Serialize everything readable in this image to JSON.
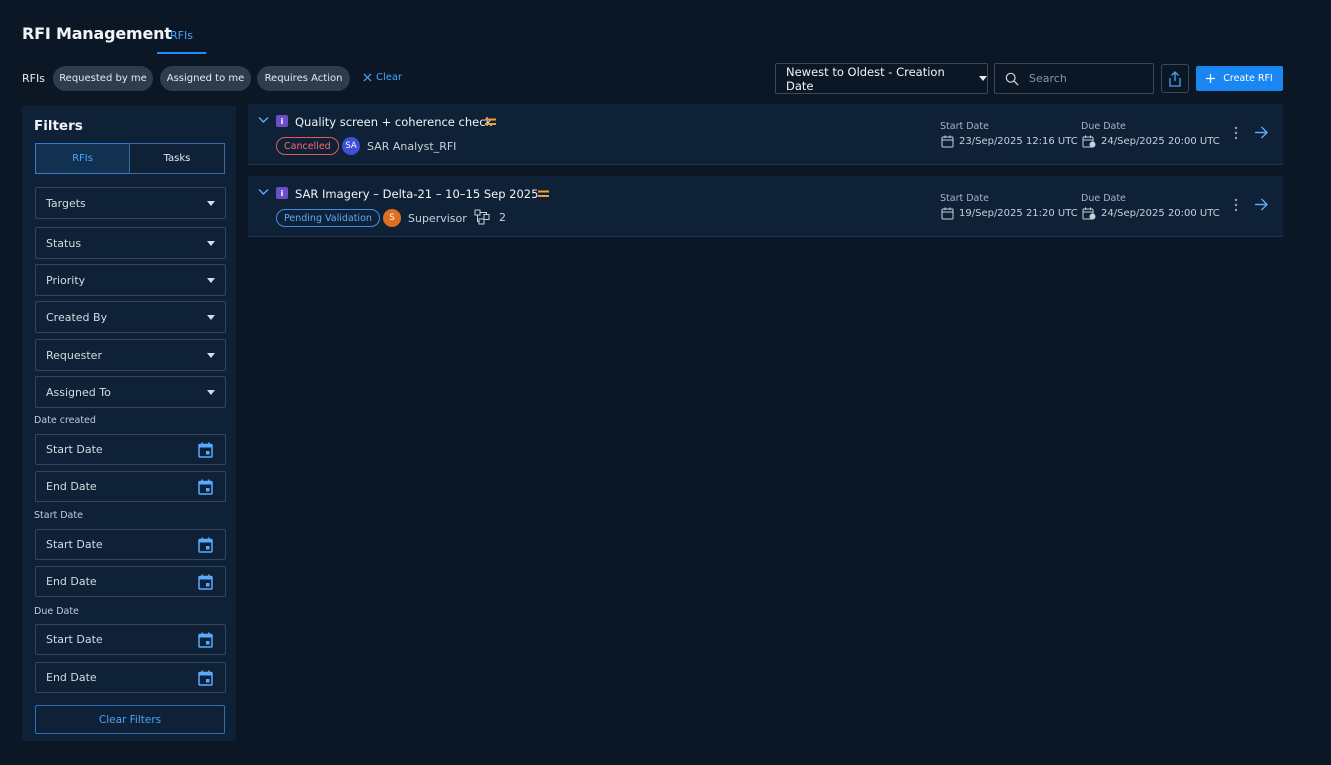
{
  "header": {
    "title": "RFI Management",
    "tab": "RFIs"
  },
  "quick_filters": {
    "label": "RFIs",
    "chips": [
      "Requested by me",
      "Assigned to me",
      "Requires Action"
    ],
    "clear": "Clear"
  },
  "toolbar": {
    "sort_value": "Newest to Oldest - Creation Date",
    "search_placeholder": "Search",
    "create_label": "Create RFI"
  },
  "sidebar": {
    "title": "Filters",
    "segments": [
      "RFIs",
      "Tasks"
    ],
    "active_segment": "RFIs",
    "dropdowns": [
      "Targets",
      "Status",
      "Priority",
      "Created By",
      "Requester",
      "Assigned To"
    ],
    "date_groups": [
      {
        "label": "Date created",
        "start": "Start Date",
        "end": "End Date"
      },
      {
        "label": "Start Date",
        "start": "Start Date",
        "end": "End Date"
      },
      {
        "label": "Due Date",
        "start": "Start Date",
        "end": "End Date"
      }
    ],
    "clear_filters": "Clear Filters"
  },
  "rfis": [
    {
      "title": "Quality screen + coherence check",
      "status": "Cancelled",
      "owner_initials": "SA",
      "owner": "SAR Analyst_RFI",
      "start_label": "Start Date",
      "start": "23/Sep/2025 12:16 UTC",
      "due_label": "Due Date",
      "due": "24/Sep/2025 20:00 UTC"
    },
    {
      "title": "SAR Imagery – Delta-21 – 10–15 Sep 2025",
      "status": "Pending Validation",
      "owner_initials": "S",
      "owner": "Supervisor",
      "workflow_count": "2",
      "start_label": "Start Date",
      "start": "19/Sep/2025 21:20 UTC",
      "due_label": "Due Date",
      "due": "24/Sep/2025 20:00 UTC"
    }
  ],
  "colors": {
    "background": "#0b1725",
    "panel": "#0f2137",
    "accent": "#1a86f2",
    "cancelled": "#ff6b6b",
    "pending": "#5aaaff",
    "priority_medium": "#f0a030",
    "avatar_sa": "#3d4fd6",
    "avatar_s": "#e07020"
  }
}
